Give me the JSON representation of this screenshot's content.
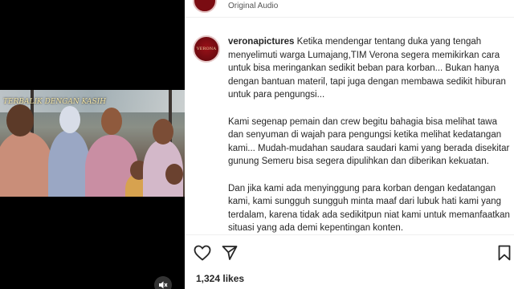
{
  "header": {
    "audio_label": "Original Audio"
  },
  "post": {
    "username": "veronapictures",
    "avatar_logo_text": "VERONA",
    "video_watermark": "TERBALIK DENGAN KASIH",
    "caption_paragraphs": [
      "Ketika mendengar tentang duka yang tengah menyelimuti warga Lumajang,TIM Verona segera memikirkan cara untuk bisa meringankan sedikit beban para korban... Bukan hanya dengan bantuan materil, tapi juga dengan membawa sedikit hiburan untuk para pengungsi...",
      "Kami segenap pemain dan crew begitu bahagia bisa melihat tawa dan senyuman di wajah para pengungsi ketika melihat kedatangan kami... Mudah-mudahan saudara saudari kami yang berada disekitar gunung Semeru bisa segera dipulihkan dan diberikan kekuatan.",
      "Dan jika kami ada menyinggung para korban dengan kedatangan kami, kami sungguh sungguh minta maaf dari lubuk hati kami yang terdalam, karena tidak ada sedikitpun niat kami untuk memanfaatkan situasi yang ada demi kepentingan konten."
    ]
  },
  "actions": {
    "like_icon": "heart-icon",
    "share_icon": "paper-plane-icon",
    "save_icon": "bookmark-icon",
    "mute_icon": "speaker-muted-icon"
  },
  "stats": {
    "likes": "1,324 likes"
  },
  "colors": {
    "brand": "#7a0c12",
    "text": "#262626"
  }
}
